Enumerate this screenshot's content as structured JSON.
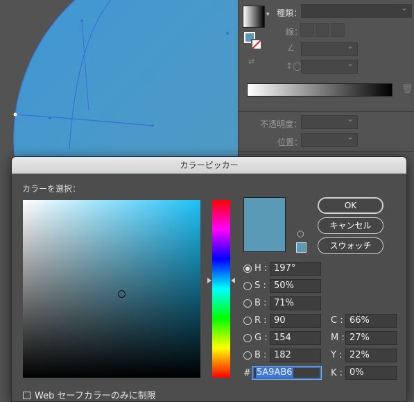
{
  "panel": {
    "kind_label": "種類：",
    "stroke_label": "線：",
    "opacity_label": "不透明度：",
    "position_label": "位置："
  },
  "dialog": {
    "title": "カラーピッカー",
    "select_label": "カラーを選択：",
    "buttons": {
      "ok": "OK",
      "cancel": "キャンセル",
      "swatches": "スウォッチ"
    },
    "web_only": "Web セーフカラーのみに制限",
    "fields": {
      "H": {
        "label": "H :",
        "value": "197°",
        "selected": true
      },
      "S": {
        "label": "S :",
        "value": "50%"
      },
      "B": {
        "label": "B :",
        "value": "71%"
      },
      "R": {
        "label": "R :",
        "value": "90"
      },
      "G": {
        "label": "G :",
        "value": "154"
      },
      "B2": {
        "label": "B :",
        "value": "182"
      },
      "C": {
        "label": "C :",
        "value": "66%"
      },
      "M": {
        "label": "M :",
        "value": "27%"
      },
      "Y": {
        "label": "Y :",
        "value": "22%"
      },
      "K": {
        "label": "K :",
        "value": "0%"
      },
      "hex": {
        "label": "#",
        "value": "5A9AB6"
      }
    },
    "current_color": "#5a9ab6",
    "pure_hue_color": "#1ec0f8"
  }
}
